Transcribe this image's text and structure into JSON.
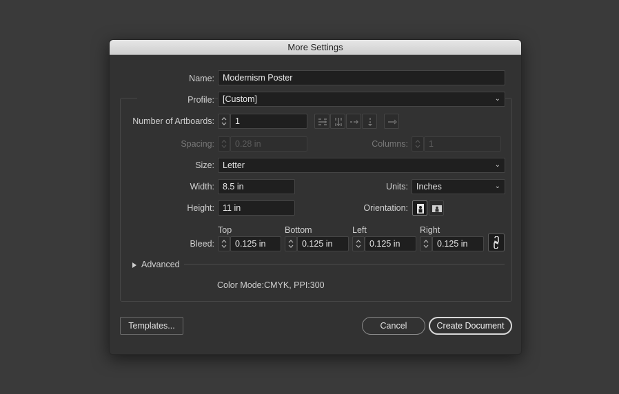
{
  "dialog": {
    "title": "More Settings"
  },
  "name": {
    "label": "Name:",
    "value": "Modernism Poster"
  },
  "profile": {
    "label": "Profile:",
    "value": "[Custom]"
  },
  "artboards": {
    "label": "Number of Artboards:",
    "value": "1"
  },
  "spacing": {
    "label": "Spacing:",
    "value": "0.28 in"
  },
  "columns": {
    "label": "Columns:",
    "value": "1"
  },
  "size": {
    "label": "Size:",
    "value": "Letter"
  },
  "width": {
    "label": "Width:",
    "value": "8.5 in"
  },
  "height": {
    "label": "Height:",
    "value": "11 in"
  },
  "units": {
    "label": "Units:",
    "value": "Inches"
  },
  "orientation": {
    "label": "Orientation:"
  },
  "bleed": {
    "label": "Bleed:",
    "top": {
      "label": "Top",
      "value": "0.125 in"
    },
    "bottom": {
      "label": "Bottom",
      "value": "0.125 in"
    },
    "left": {
      "label": "Left",
      "value": "0.125 in"
    },
    "right": {
      "label": "Right",
      "value": "0.125 in"
    }
  },
  "advanced": {
    "label": "Advanced"
  },
  "color_mode": "Color Mode:CMYK, PPI:300",
  "buttons": {
    "templates": "Templates...",
    "cancel": "Cancel",
    "create": "Create Document"
  }
}
